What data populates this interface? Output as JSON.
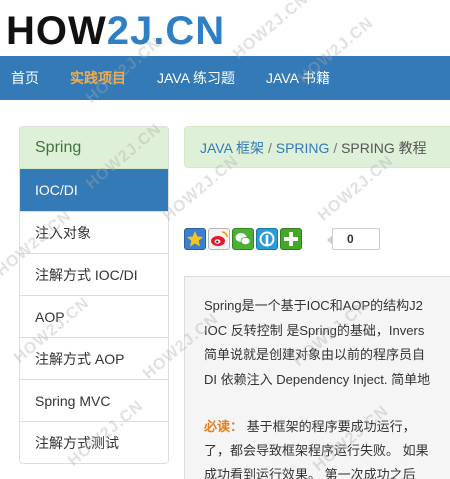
{
  "logo": {
    "part1": "HOW",
    "part2": "2J",
    "part3": ".CN"
  },
  "navbar": {
    "items": [
      {
        "label": "首页"
      },
      {
        "label": "实践项目"
      },
      {
        "label": "JAVA 练习题"
      },
      {
        "label": "JAVA 书籍"
      }
    ]
  },
  "sidebar": {
    "title": "Spring",
    "items": [
      {
        "label": "IOC/DI"
      },
      {
        "label": "注入对象"
      },
      {
        "label": "注解方式 IOC/DI"
      },
      {
        "label": "AOP"
      },
      {
        "label": "注解方式 AOP"
      },
      {
        "label": "Spring MVC"
      },
      {
        "label": "注解方式测试"
      }
    ]
  },
  "breadcrumb": {
    "item1": "JAVA 框架",
    "sep": "/",
    "item2": "SPRING",
    "item3": "SPRING 教程"
  },
  "share": {
    "count": "0"
  },
  "content": {
    "line1": "Spring是一个基于IOC和AOP的结构J2",
    "line2": "IOC 反转控制 是Spring的基础，Invers",
    "line3": "简单说就是创建对象由以前的程序员自",
    "line4": "DI 依赖注入 Dependency Inject. 简单地",
    "warn_label": "必读：",
    "line5_rest": " 基于框架的程序要成功运行，",
    "line6": "了，都会导致框架程序运行失败。 如果",
    "line7": "成功看到运行效果。 第一次成功之后"
  },
  "watermark": {
    "text": "HOW2J.CN"
  },
  "colors": {
    "nav_bg": "#337ab7",
    "nav_active": "#f0ad4e",
    "panel_green": "#dff0d8",
    "link": "#337ab7",
    "warn": "#e67e22"
  }
}
